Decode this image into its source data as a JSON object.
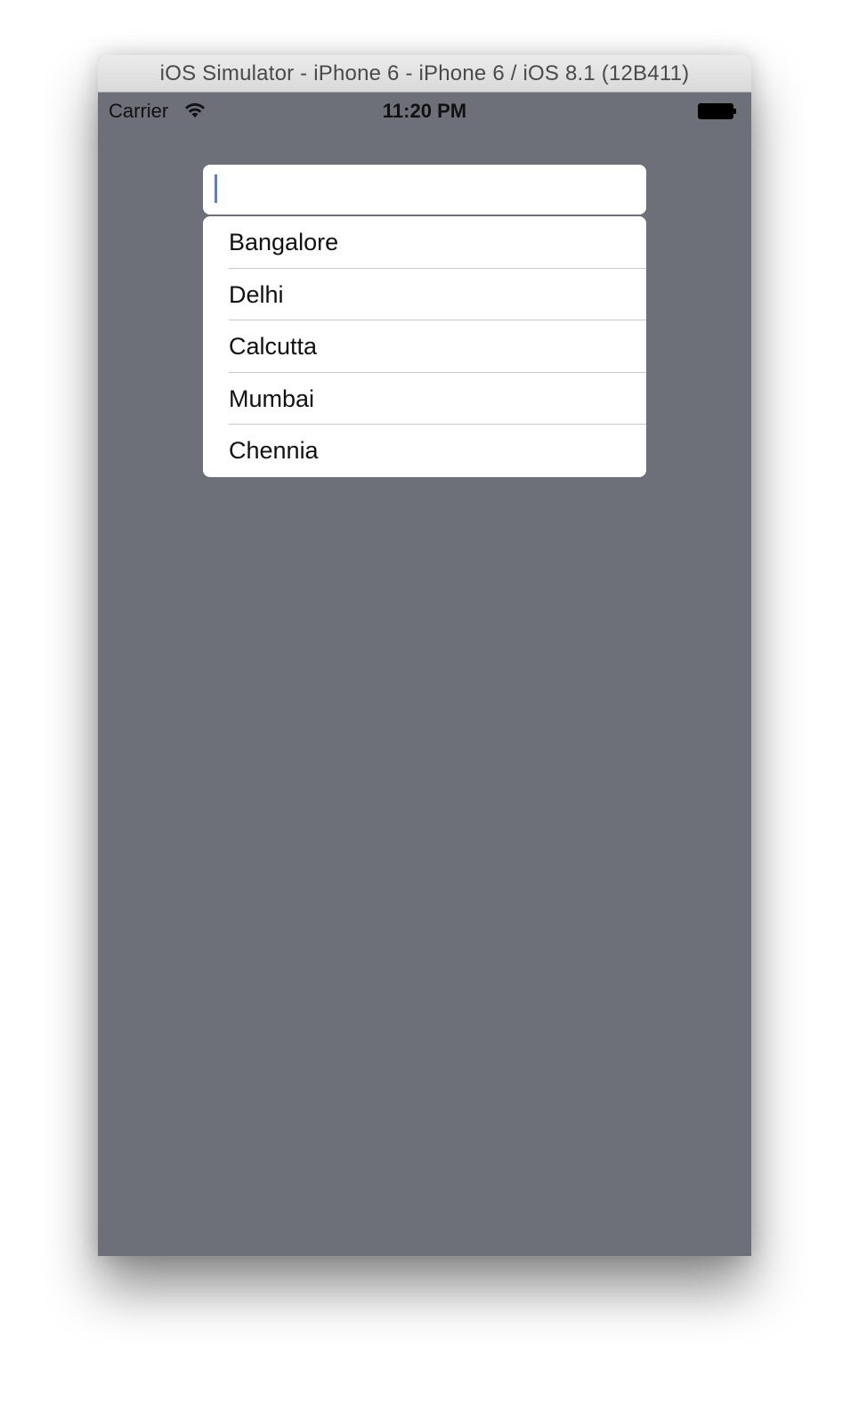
{
  "window": {
    "title": "iOS Simulator - iPhone 6 - iPhone 6 / iOS 8.1 (12B411)"
  },
  "status_bar": {
    "carrier": "Carrier",
    "time": "11:20 PM",
    "wifi_icon": "wifi-icon",
    "battery_icon": "battery-icon"
  },
  "search": {
    "value": "",
    "placeholder": ""
  },
  "dropdown": {
    "items": [
      {
        "label": "Bangalore"
      },
      {
        "label": "Delhi"
      },
      {
        "label": "Calcutta"
      },
      {
        "label": "Mumbai"
      },
      {
        "label": "Chennia"
      }
    ]
  },
  "colors": {
    "screen_background": "#6e7079",
    "caret": "#4a7ef6",
    "separator": "#c8c7cc"
  }
}
